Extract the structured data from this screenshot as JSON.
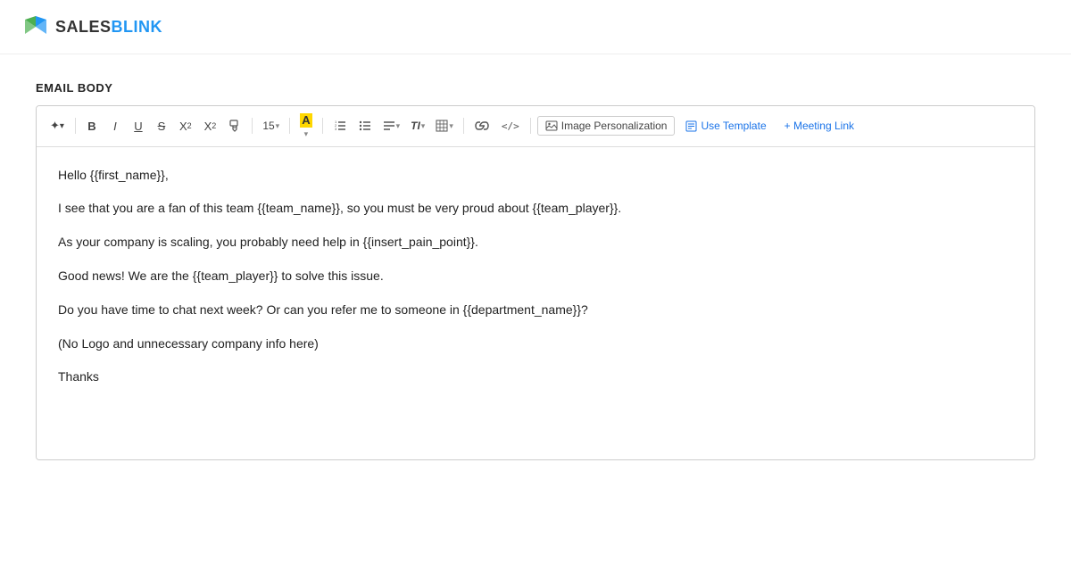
{
  "logo": {
    "sales": "SALES",
    "blink": "BLINK"
  },
  "section": {
    "label": "EMAIL BODY"
  },
  "toolbar": {
    "bold": "B",
    "italic": "I",
    "underline": "U",
    "strikethrough": "S",
    "superscript": "X",
    "subscript": "X",
    "font_size": "15",
    "font_color_letter": "A",
    "list_ordered": "≡",
    "list_unordered": "≡",
    "align": "≡",
    "text_style": "TI",
    "table": "⊞",
    "link": "🔗",
    "code": "</>",
    "image_personalization": "Image Personalization",
    "use_template": "Use Template",
    "meeting_link": "+ Meeting Link"
  },
  "email_body": {
    "line1": "Hello {{first_name}},",
    "line2": "I see that you are a fan of this team {{team_name}}, so you must be very proud about {{team_player}}.",
    "line3": "As your company is scaling, you probably need help in {{insert_pain_point}}.",
    "line4": "Good news! We are the {{team_player}} to solve this issue.",
    "line5": "Do you have time to chat next week? Or can you refer me to someone in {{department_name}}?",
    "line6": "(No Logo and unnecessary company info here)",
    "line7": "Thanks"
  }
}
